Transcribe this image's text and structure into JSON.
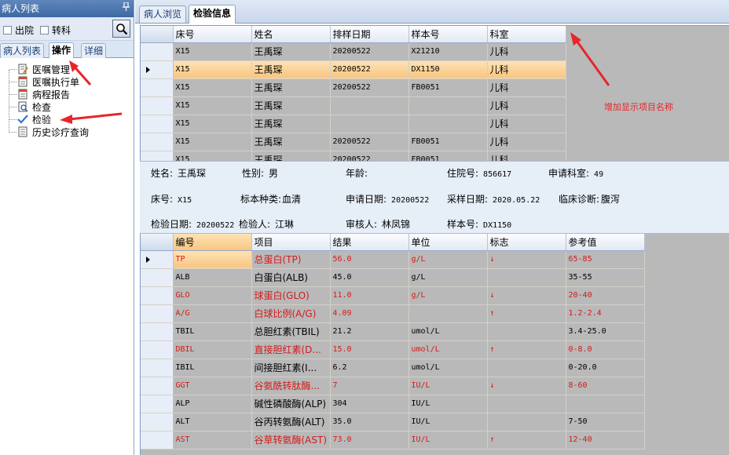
{
  "left_panel": {
    "title": "病人列表",
    "pin": "ᵖ",
    "filters": [
      {
        "label": "出院"
      },
      {
        "label": "转科"
      }
    ],
    "tabs": [
      {
        "label": "病人列表"
      },
      {
        "label": "操作"
      },
      {
        "label": "详细"
      }
    ],
    "tree": [
      {
        "label": "医嘱管理",
        "icon": "edit-doc-icon"
      },
      {
        "label": "医嘱执行单",
        "icon": "doc-icon"
      },
      {
        "label": "病程报告",
        "icon": "doc-icon"
      },
      {
        "label": "检查",
        "icon": "doc-search-icon"
      },
      {
        "label": "检验",
        "icon": "check-icon"
      },
      {
        "label": "历史诊疗查询",
        "icon": "list-icon"
      }
    ]
  },
  "right_panel": {
    "tabs": [
      {
        "label": "病人浏览"
      },
      {
        "label": "检验信息"
      }
    ],
    "sample_grid": {
      "columns": [
        "床号",
        "姓名",
        "排样日期",
        "样本号",
        "科室"
      ],
      "rows": [
        [
          "X15",
          "王禹琛",
          "20200522",
          "X21210",
          "儿科"
        ],
        [
          "X15",
          "王禹琛",
          "20200522",
          "DX1150",
          "儿科"
        ],
        [
          "X15",
          "王禹琛",
          "20200522",
          "FB0051",
          "儿科"
        ],
        [
          "X15",
          "王禹琛",
          "",
          "",
          "儿科"
        ],
        [
          "X15",
          "王禹琛",
          "",
          "",
          "儿科"
        ],
        [
          "X15",
          "王禹琛",
          "20200522",
          "FB0051",
          "儿科"
        ],
        [
          "X15",
          "王禹琛",
          "20200522",
          "FB0051",
          "儿科"
        ]
      ]
    },
    "annotation": "增加显示项目名称",
    "info": {
      "name_label": "姓名:",
      "name": "王禹琛",
      "sex_label": "性别:",
      "sex": "男",
      "age_label": "年龄:",
      "age": "",
      "inpatient_label": "住院号:",
      "inpatient": "856617",
      "dept_label": "申请科室:",
      "dept": "49",
      "bed_label": "床号:",
      "bed": "X15",
      "specimen_label": "标本种类:",
      "specimen": "血清",
      "apply_date_label": "申请日期:",
      "apply_date": "20200522",
      "sample_date_label": "采样日期:",
      "sample_date": "2020.05.22",
      "diag_label": "临床诊断:",
      "diag": "腹泻",
      "test_date_label": "检验日期:",
      "test_date": "20200522",
      "tester_label": "检验人:",
      "tester": "江琳",
      "reviewer_label": "审核人:",
      "reviewer": "林凤锦",
      "sample_no_label": "样本号:",
      "sample_no": "DX1150"
    },
    "result_grid": {
      "columns": [
        "编号",
        "项目",
        "结果",
        "单位",
        "标志",
        "参考值"
      ],
      "rows": [
        {
          "code": "TP",
          "item": "总蛋白(TP)",
          "result": "56.0",
          "unit": "g/L",
          "flag": "↓",
          "ref": "65-85",
          "abnormal": true
        },
        {
          "code": "ALB",
          "item": "白蛋白(ALB)",
          "result": "45.0",
          "unit": "g/L",
          "flag": "",
          "ref": "35-55",
          "abnormal": false
        },
        {
          "code": "GLO",
          "item": "球蛋白(GLO)",
          "result": "11.0",
          "unit": "g/L",
          "flag": "↓",
          "ref": "20-40",
          "abnormal": true
        },
        {
          "code": "A/G",
          "item": "白球比例(A/G)",
          "result": "4.09",
          "unit": "",
          "flag": "↑",
          "ref": "1.2-2.4",
          "abnormal": true
        },
        {
          "code": "TBIL",
          "item": "总胆红素(TBIL)",
          "result": "21.2",
          "unit": "umol/L",
          "flag": "",
          "ref": "3.4-25.0",
          "abnormal": false
        },
        {
          "code": "DBIL",
          "item": "直接胆红素(D...",
          "result": "15.0",
          "unit": "umol/L",
          "flag": "↑",
          "ref": "0-8.0",
          "abnormal": true
        },
        {
          "code": "IBIL",
          "item": "间接胆红素(I...",
          "result": "6.2",
          "unit": "umol/L",
          "flag": "",
          "ref": "0-20.0",
          "abnormal": false
        },
        {
          "code": "GGT",
          "item": "谷氨酰转肽酶...",
          "result": "7",
          "unit": "IU/L",
          "flag": "↓",
          "ref": "8-60",
          "abnormal": true
        },
        {
          "code": "ALP",
          "item": "碱性磷酸酶(ALP)",
          "result": "304",
          "unit": "IU/L",
          "flag": "",
          "ref": "",
          "abnormal": false
        },
        {
          "code": "ALT",
          "item": "谷丙转氨酶(ALT)",
          "result": "35.0",
          "unit": "IU/L",
          "flag": "",
          "ref": "7-50",
          "abnormal": false
        },
        {
          "code": "AST",
          "item": "谷草转氨酶(AST)",
          "result": "73.0",
          "unit": "IU/L",
          "flag": "↑",
          "ref": "12-40",
          "abnormal": true
        }
      ]
    }
  },
  "colors": {
    "abnormal": "#d21b1b",
    "selected_row": "#f8c580",
    "annotation": "#e8252a"
  }
}
